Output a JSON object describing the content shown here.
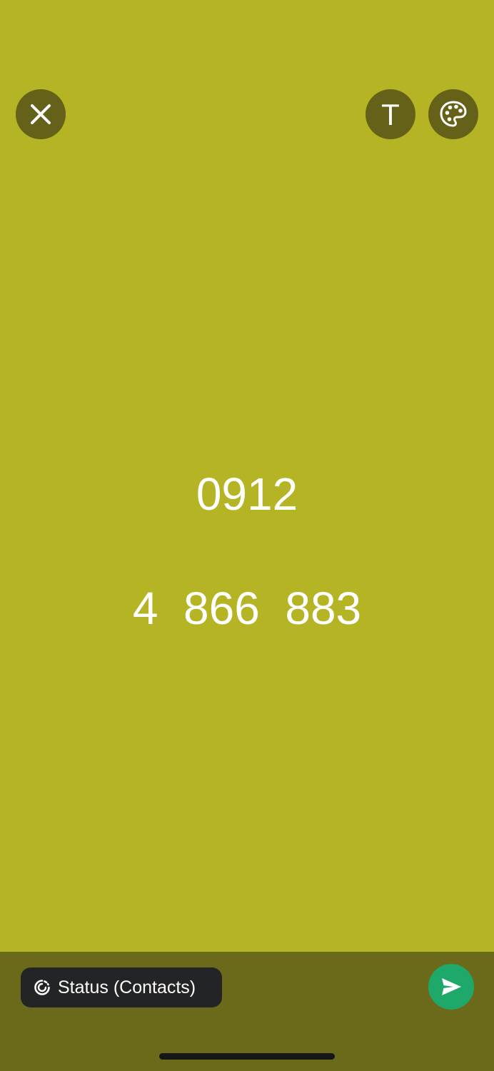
{
  "colors": {
    "background": "#b5b425",
    "button_background": "#656118",
    "bottom_bar": "#6b6a1a",
    "pill_background": "#232425",
    "send_button": "#1ea96b"
  },
  "toolbar": {
    "close_icon": "close-icon",
    "text_tool_label": "T",
    "palette_icon": "palette-icon"
  },
  "status": {
    "lines": [
      "0912",
      "4  866  883"
    ]
  },
  "footer": {
    "audience_label": "Status (Contacts)",
    "audience_icon": "status-ring-icon",
    "send_icon": "send-icon"
  }
}
